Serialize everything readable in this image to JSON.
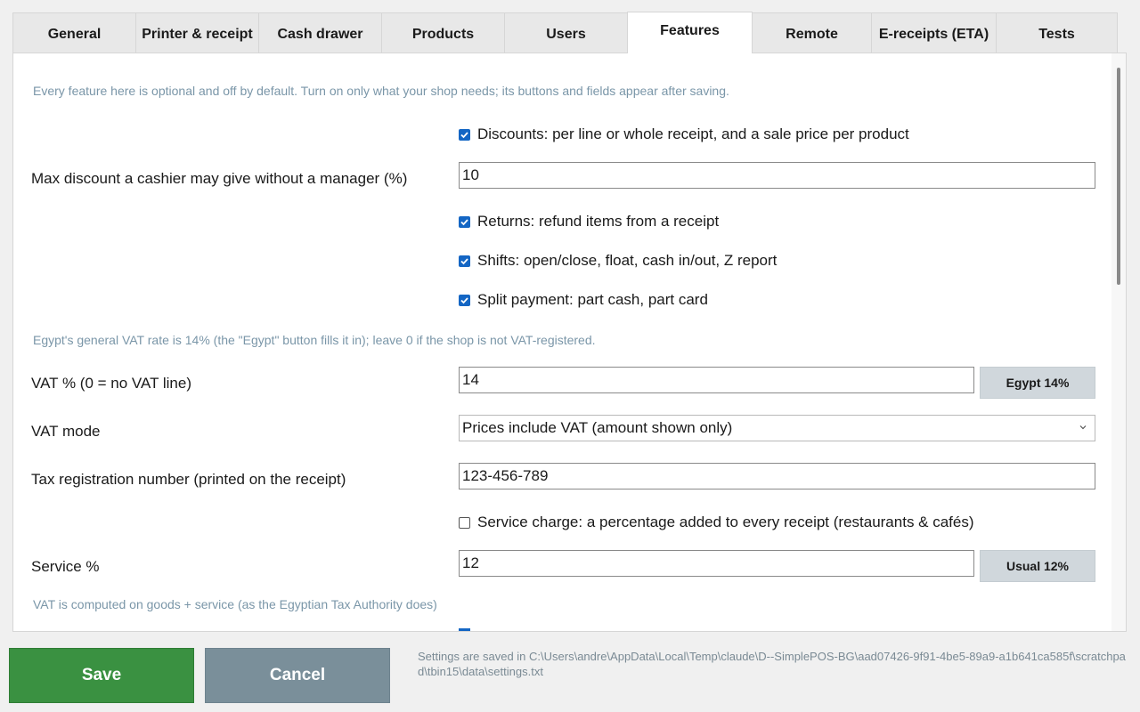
{
  "tabs": [
    {
      "label": "General"
    },
    {
      "label": "Printer & receipt"
    },
    {
      "label": "Cash drawer"
    },
    {
      "label": "Products"
    },
    {
      "label": "Users"
    },
    {
      "label": "Features",
      "active": true
    },
    {
      "label": "Remote"
    },
    {
      "label": "E-receipts (ETA)"
    },
    {
      "label": "Tests"
    }
  ],
  "features": {
    "intro_hint": "Every feature here is optional and off by default. Turn on only what your shop needs; its buttons and fields appear after saving.",
    "discounts": {
      "label": "Discounts: per line or whole receipt, and a sale price per product",
      "checked": true
    },
    "max_discount": {
      "label": "Max discount a cashier may give without a manager (%)",
      "value": "10"
    },
    "returns": {
      "label": "Returns: refund items from a receipt",
      "checked": true
    },
    "shifts": {
      "label": "Shifts: open/close, float, cash in/out, Z report",
      "checked": true
    },
    "split_payment": {
      "label": "Split payment: part cash, part card",
      "checked": true
    },
    "vat_hint": "Egypt's general VAT rate is 14% (the \"Egypt\" button fills it in); leave 0 if the shop is not VAT-registered.",
    "vat_percent": {
      "label": "VAT % (0 = no VAT line)",
      "value": "14",
      "button": "Egypt 14%"
    },
    "vat_mode": {
      "label": "VAT mode",
      "selected": "Prices include VAT (amount shown only)"
    },
    "tax_reg": {
      "label": "Tax registration number (printed on the receipt)",
      "value": "123-456-789"
    },
    "service_charge": {
      "label": "Service charge: a percentage added to every receipt (restaurants & cafés)",
      "checked": false
    },
    "service_percent": {
      "label": "Service %",
      "value": "12",
      "button": "Usual 12%"
    },
    "service_hint": "VAT is computed on goods + service (as the Egyptian Tax Authority does)"
  },
  "footer": {
    "save_label": "Save",
    "cancel_label": "Cancel",
    "settings_note": "Settings are saved in C:\\Users\\andre\\AppData\\Local\\Temp\\claude\\D--SimplePOS-BG\\aad07426-9f91-4be5-89a9-a1b641ca585f\\scratchpad\\tbin15\\data\\settings.txt"
  },
  "colors": {
    "accent": "#1466c4",
    "save": "#3a9141",
    "cancel": "#7a8f9a",
    "hint": "#7a96a8"
  }
}
